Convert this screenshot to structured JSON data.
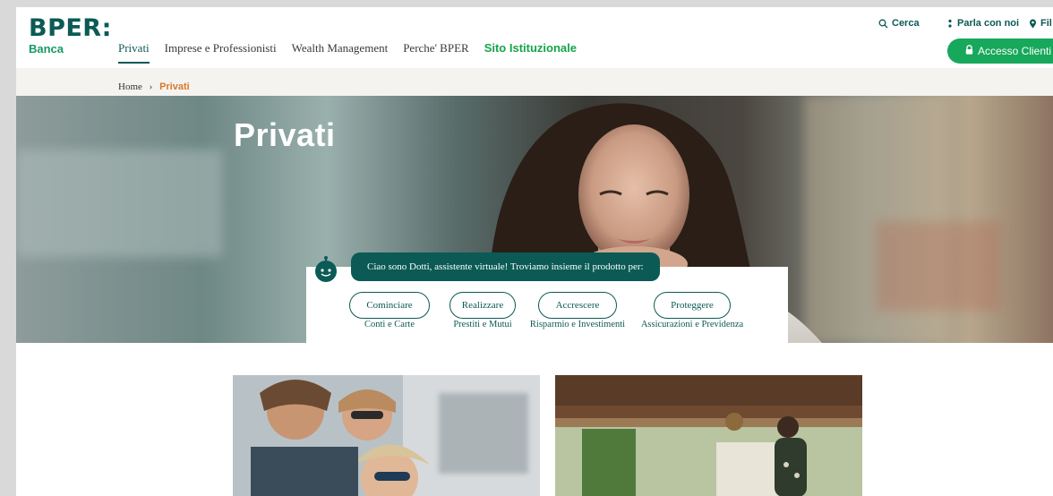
{
  "brand": {
    "name": "BPER:",
    "sub": "Banca"
  },
  "nav": {
    "items": [
      "Privati",
      "Imprese e Professionisti",
      "Wealth Management",
      "Perche' BPER",
      "Sito Istituzionale"
    ]
  },
  "utility": {
    "search": "Cerca",
    "contact": "Parla con noi",
    "branches": "Fil"
  },
  "access_button": "Accesso Clienti",
  "breadcrumb": {
    "home": "Home",
    "separator": "›",
    "current": "Privati"
  },
  "hero": {
    "title": "Privati"
  },
  "assistant": {
    "message": "Ciao sono Dotti, assistente virtuale! Troviamo insieme il prodotto per:",
    "options": [
      {
        "label": "Cominciare",
        "caption": "Conti e Carte"
      },
      {
        "label": "Realizzare",
        "caption": "Prestiti e Mutui"
      },
      {
        "label": "Accrescere",
        "caption": "Risparmio e Investimenti"
      },
      {
        "label": "Proteggere",
        "caption": "Assicurazioni e Previdenza"
      }
    ]
  },
  "colors": {
    "brand": "#0b5a55",
    "accent_green": "#17a85b",
    "breadcrumb_current": "#d9782a"
  },
  "icons": [
    "search-icon",
    "chat-icon",
    "location-pin-icon",
    "lock-icon",
    "robot-avatar-icon"
  ]
}
